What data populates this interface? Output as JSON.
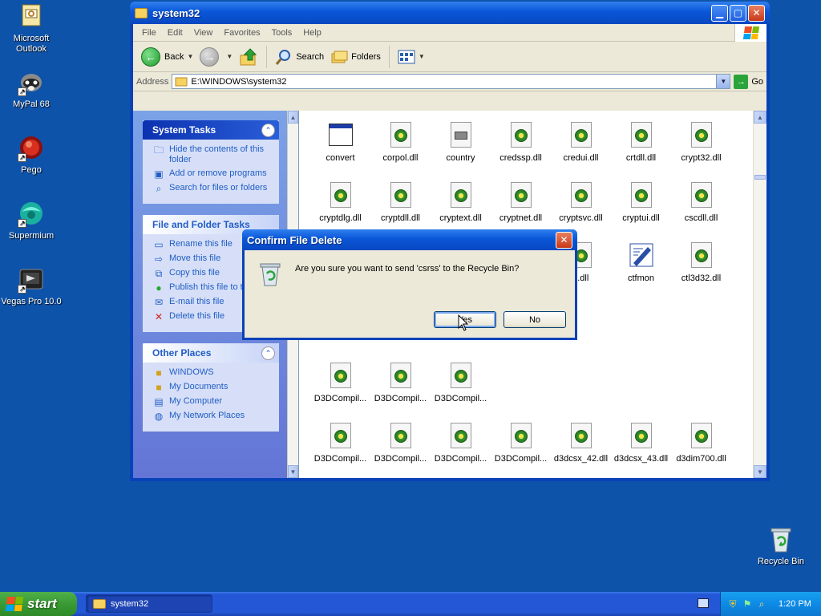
{
  "desktop": {
    "icons": [
      {
        "label": "Microsoft Outlook"
      },
      {
        "label": "MyPal 68"
      },
      {
        "label": "Pego"
      },
      {
        "label": "Supermium"
      },
      {
        "label": "Vegas Pro 10.0"
      },
      {
        "label": "Recycle Bin"
      }
    ]
  },
  "window": {
    "title": "system32",
    "menu": [
      "File",
      "Edit",
      "View",
      "Favorites",
      "Tools",
      "Help"
    ],
    "toolbar": {
      "back": "Back",
      "search": "Search",
      "folders": "Folders"
    },
    "address": {
      "label": "Address",
      "value": "E:\\WINDOWS\\system32",
      "go": "Go"
    },
    "system_tasks": {
      "title": "System Tasks",
      "items": [
        "Hide the contents of this folder",
        "Add or remove programs",
        "Search for files or folders"
      ]
    },
    "file_tasks": {
      "title": "File and Folder Tasks",
      "items": [
        "Rename this file",
        "Move this file",
        "Copy this file",
        "Publish this file to the Web",
        "E-mail this file",
        "Delete this file"
      ]
    },
    "other_places": {
      "title": "Other Places",
      "items": [
        "WINDOWS",
        "My Documents",
        "My Computer",
        "My Network Places"
      ]
    },
    "files": [
      {
        "name": "convert",
        "type": "exe"
      },
      {
        "name": "corpol.dll",
        "type": "dll"
      },
      {
        "name": "country",
        "type": "sys"
      },
      {
        "name": "credssp.dll",
        "type": "dll"
      },
      {
        "name": "credui.dll",
        "type": "dll"
      },
      {
        "name": "crtdll.dll",
        "type": "dll"
      },
      {
        "name": "crypt32.dll",
        "type": "dll"
      },
      {
        "name": "cryptdlg.dll",
        "type": "dll"
      },
      {
        "name": "cryptdll.dll",
        "type": "dll"
      },
      {
        "name": "cryptext.dll",
        "type": "dll"
      },
      {
        "name": "cryptnet.dll",
        "type": "dll"
      },
      {
        "name": "cryptsvc.dll",
        "type": "dll"
      },
      {
        "name": "cryptui.dll",
        "type": "dll"
      },
      {
        "name": "cscdll.dll",
        "type": "dll"
      },
      {
        "name": "k.dll",
        "type": "dll"
      },
      {
        "name": "ctfmon",
        "type": "ctf"
      },
      {
        "name": "ctl3d32.dll",
        "type": "dll"
      },
      {
        "name": "D3DCompil...",
        "type": "dll"
      },
      {
        "name": "D3DCompil...",
        "type": "dll"
      },
      {
        "name": "D3DCompil...",
        "type": "dll"
      },
      {
        "name": "D3DCompil...",
        "type": "dll"
      },
      {
        "name": "D3DCompil...",
        "type": "dll"
      },
      {
        "name": "D3DCompil...",
        "type": "dll"
      },
      {
        "name": "D3DCompil...",
        "type": "dll"
      },
      {
        "name": "d3dcsx_42.dll",
        "type": "dll"
      },
      {
        "name": "d3dcsx_43.dll",
        "type": "dll"
      },
      {
        "name": "d3dim700.dll",
        "type": "dll"
      }
    ]
  },
  "dialog": {
    "title": "Confirm File Delete",
    "message": "Are you sure you want to send 'csrss' to the Recycle Bin?",
    "yes": "Yes",
    "no": "No"
  },
  "taskbar": {
    "start": "start",
    "task": "system32",
    "clock": "1:20 PM"
  },
  "colors": {
    "desktop": "#0e53aa",
    "titlebar": "#0a56d8",
    "taskbar": "#2457d6",
    "start": "#3a9a34"
  }
}
